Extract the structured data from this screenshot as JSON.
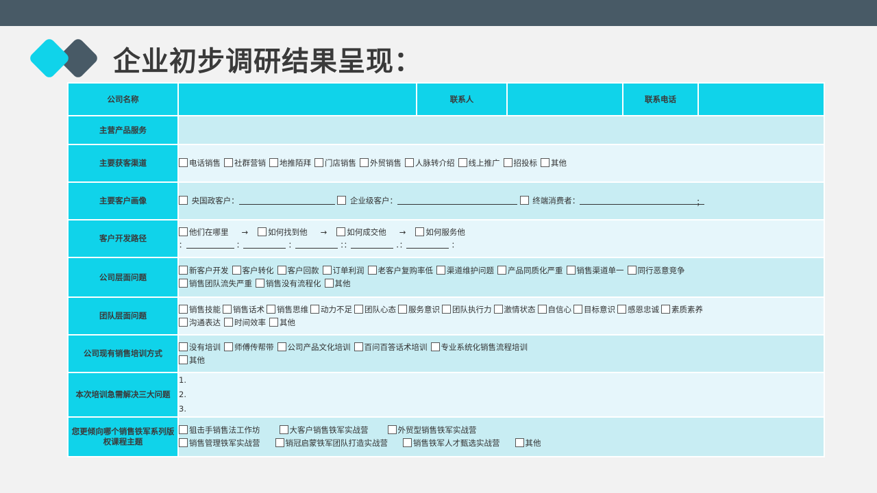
{
  "title": "企业初步调研结果呈现：",
  "colors": {
    "topbar": "#485a66",
    "accent": "#10d3ea",
    "row_a": "#c8edf3",
    "row_b": "#e6f6fb",
    "logo_dark": "#485a66"
  },
  "header": {
    "company_label": "公司名称",
    "company_value": "",
    "contact_label": "联系人",
    "contact_value": "",
    "phone_label": "联系电话",
    "phone_value": ""
  },
  "rows": {
    "products": {
      "label": "主营产品服务",
      "value": ""
    },
    "channels": {
      "label": "主要获客渠道",
      "options": [
        "电话销售",
        "社群营销",
        "地推陌拜",
        "门店销售",
        "外贸销售",
        "人脉转介绍",
        "线上推广",
        "招投标",
        "其他"
      ]
    },
    "customers": {
      "label": "主要客户画像",
      "gov": "央国政客户：",
      "enterprise": "企业级客户：",
      "consumer": "终端消费者：",
      "end": "；"
    },
    "path": {
      "label": "客户开发路径",
      "steps": [
        "他们在哪里",
        "如何找到他",
        "如何成交他",
        "如何服务他"
      ],
      "arrow": "→",
      "colon": "：",
      "colon_pair": "：：",
      "colon_dot": "．："
    },
    "company_issues": {
      "label": "公司层面问题",
      "line1": [
        "新客户开发",
        "客户转化",
        "客户回款",
        "订单利润",
        "老客户复购率低",
        "渠道维护问题",
        "产品同质化严重",
        "销售渠道单一",
        "同行恶意竞争"
      ],
      "line2": [
        "销售团队流失严重",
        "销售没有流程化",
        "其他"
      ]
    },
    "team_issues": {
      "label": "团队层面问题",
      "line1": [
        "销售技能",
        "销售话术",
        "销售思维",
        "动力不足",
        "团队心态",
        "服务意识",
        "团队执行力",
        "激情状态",
        "自信心",
        "目标意识",
        "感恩忠诚",
        "素质素养"
      ],
      "line2": [
        "沟通表达",
        "时间效率",
        "其他"
      ]
    },
    "training": {
      "label": "公司现有销售培训方式",
      "line1": [
        "没有培训",
        "师傅传帮带",
        "公司产品文化培训",
        "百问百答话术培训",
        "专业系统化销售流程培训"
      ],
      "line2": [
        "其他"
      ]
    },
    "problems": {
      "label": "本次培训急需解决三大问题",
      "items": [
        "1.",
        "2.",
        "3."
      ]
    },
    "courses": {
      "label": "您更倾向哪个销售铁军系列版权课程主题",
      "line1": [
        "狙击手销售法工作坊",
        "大客户销售铁军实战营",
        "外贸型销售铁军实战营"
      ],
      "line2": [
        "销售管理铁军实战营",
        "销冠启蒙铁军团队打造实战营",
        "销售铁军人才甄选实战营",
        "其他"
      ]
    }
  }
}
